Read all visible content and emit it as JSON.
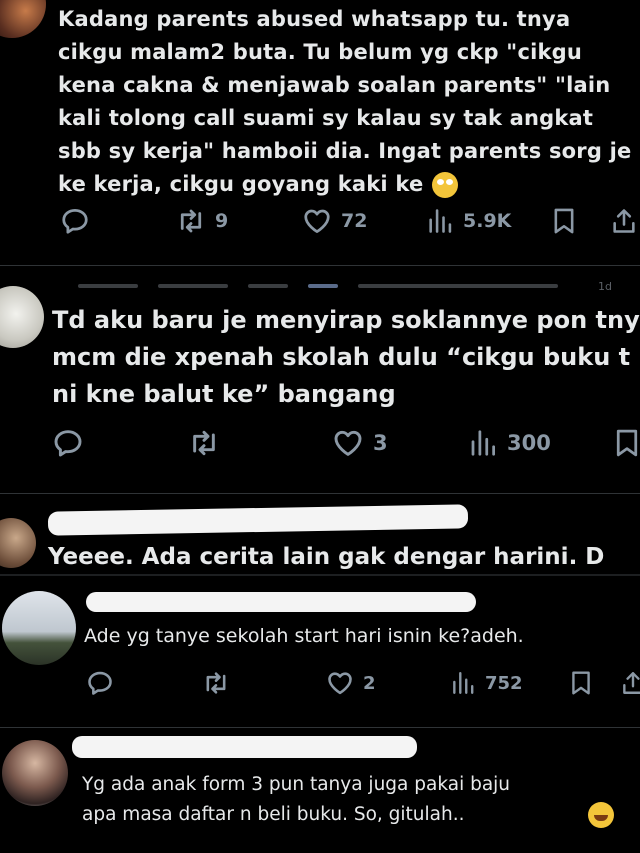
{
  "posts": [
    {
      "text": "Kadang parents abused whatsapp tu. tnya\ncikgu malam2 buta. Tu belum yg ckp \"cikgu\nkena cakna & menjawab soalan parents\" \"lain\nkali tolong call suami sy kalau sy tak angkat\nsbb sy kerja\" hamboii dia. Ingat parents sorg je\nke kerja, cikgu goyang kaki ke",
      "emoji": "face-with-rolling-eyes",
      "retweets": "9",
      "likes": "72",
      "views": "5.9K"
    },
    {
      "header_partial": "1d",
      "text": "Td aku baru je menyirap soklannye pon tny\nmcm die xpenah skolah dulu “cikgu buku t\nni kne balut ke” bangang",
      "likes": "3",
      "views": "300"
    },
    {
      "text": "Yeeee. Ada cerita lain gak dengar harini. D"
    },
    {
      "text": "Ade yg tanye sekolah start hari isnin ke?adeh.",
      "likes": "2",
      "views": "752"
    },
    {
      "text": "Yg ada anak form 3 pun tanya juga pakai baju\napa masa daftar n beli buku.  So, gitulah..",
      "emoji": "grinning-face-with-sweat"
    }
  ],
  "icons": [
    "reply-icon",
    "retweet-icon",
    "like-icon",
    "views-icon",
    "bookmark-icon",
    "share-icon"
  ],
  "colors": {
    "background": "#000000",
    "text": "#e7e9ea",
    "muted": "#8b98a5",
    "redaction": "#f4f4f4"
  }
}
